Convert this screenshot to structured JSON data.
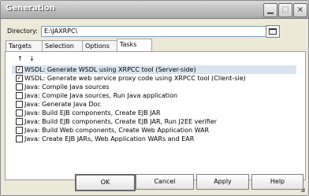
{
  "window": {
    "title": "Generation"
  },
  "directory": {
    "label": "Directory:",
    "value": "E:\\JAXRPC\\"
  },
  "tabs": [
    {
      "label": "Targets"
    },
    {
      "label": "Selection"
    },
    {
      "label": "Options"
    },
    {
      "label": "Tasks"
    }
  ],
  "arrows": {
    "up": "↑",
    "down": "↓"
  },
  "tasks": [
    {
      "label": "WSDL: Generate WSDL using XRPCC tool (Server-side)",
      "checked": true,
      "selected": true
    },
    {
      "label": "WSDL: Generate web service proxy code using XRPCC tool (Client-sie)",
      "checked": true,
      "selected": false
    },
    {
      "label": "Java: Compile Java sources",
      "checked": false,
      "selected": false
    },
    {
      "label": "Java: Compile Java sources, Run Java application",
      "checked": false,
      "selected": false
    },
    {
      "label": "Java: Generate Java Doc",
      "checked": false,
      "selected": false
    },
    {
      "label": "Java: Build EJB components, Create EJB JAR",
      "checked": false,
      "selected": false
    },
    {
      "label": "Java: Build EJB components, Create EJB JAR, Run J2EE verifier",
      "checked": false,
      "selected": false
    },
    {
      "label": "Java: Build Web components, Create Web Application WAR",
      "checked": false,
      "selected": false
    },
    {
      "label": "Java: Create EJB JARs, Web Application WARs and EAR",
      "checked": false,
      "selected": false
    }
  ],
  "buttons": {
    "ok": "OK",
    "cancel": "Cancel",
    "apply": "Apply",
    "help": "Help"
  }
}
